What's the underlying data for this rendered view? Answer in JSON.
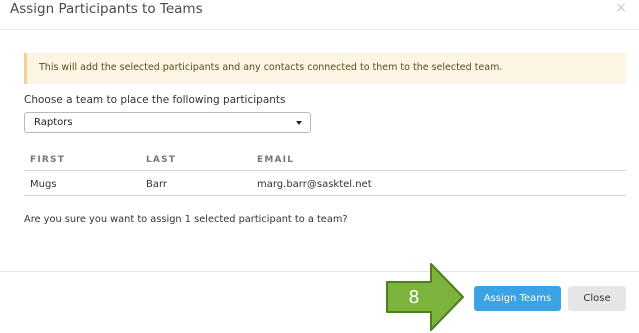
{
  "modal": {
    "title": "Assign Participants to Teams",
    "close_glyph": "×"
  },
  "alert": {
    "text": "This will add the selected participants and any contacts connected to them to the selected team."
  },
  "team_select": {
    "label": "Choose a team to place the following participants",
    "selected": "Raptors",
    "icon": "chevron-down-icon"
  },
  "table": {
    "headers": [
      "FIRST",
      "LAST",
      "EMAIL"
    ],
    "rows": [
      [
        "Mugs",
        "Barr",
        "marg.barr@sasktel.net"
      ]
    ]
  },
  "confirm_text": "Are you sure you want to assign 1 selected participant to a team?",
  "footer": {
    "assign_label": "Assign Teams",
    "close_label": "Close"
  },
  "annotation": {
    "step_number": "8",
    "arrow_color": "#7bb33d",
    "arrow_border": "#4e7d22"
  },
  "colors": {
    "primary": "#3aa3e3",
    "alert_bg": "#fcf5e3",
    "alert_border": "#f2d195"
  }
}
